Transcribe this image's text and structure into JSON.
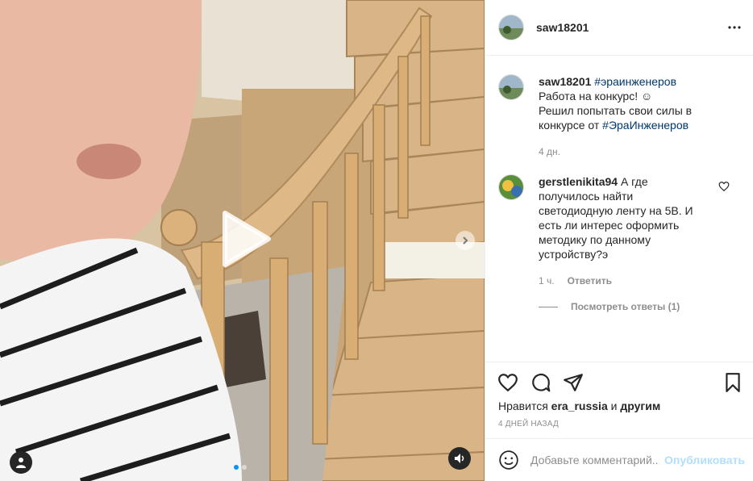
{
  "post": {
    "author": "saw18201",
    "more_icon": "more-horizontal-icon"
  },
  "caption": {
    "author": "saw18201",
    "hashtag": "#эраинженеров",
    "line1": "Работа на конкурс! ☺",
    "line2": "Решил попытать свои силы в конкурсе от ",
    "hashtag2": "#ЭраИнженеров",
    "time": "4 дн."
  },
  "comment": {
    "author": "gerstlenikita94",
    "text": "А где получилось найти светодиодную ленту на 5В. И есть ли интерес оформить методику по данному устройству?э",
    "time": "1 ч.",
    "reply_label": "Ответить",
    "view_replies": "Посмотреть ответы (1)"
  },
  "likes": {
    "prefix": "Нравится ",
    "user": "era_russia",
    "conj": " и ",
    "others": "другим"
  },
  "date": "4 ДНЕЙ НАЗАД",
  "comment_input": {
    "placeholder": "Добавьте комментарий...",
    "submit_label": "Опубликовать"
  },
  "media": {
    "carousel_count": 2,
    "carousel_active": 0,
    "icons": [
      "play-icon",
      "chevron-right-icon",
      "user-tag-icon",
      "sound-icon"
    ]
  },
  "colors": {
    "link": "#00376b",
    "secondary": "#8e8e8e",
    "post_disabled": "#b2dffc",
    "border": "#efefef"
  }
}
